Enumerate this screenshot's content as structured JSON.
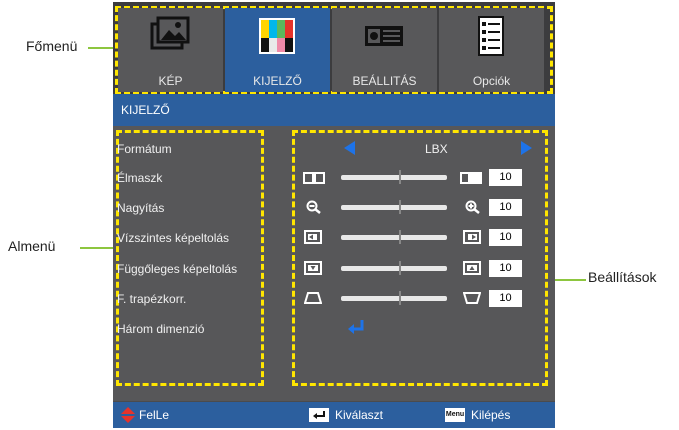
{
  "callouts": {
    "main_menu": "Főmenü",
    "sub_menu": "Almenü",
    "settings": "Beállítások"
  },
  "tabs": [
    {
      "label": "KÉP",
      "icon": "picture-icon"
    },
    {
      "label": "KIJELZŐ",
      "icon": "display-icon"
    },
    {
      "label": "BEÁLLITÁS",
      "icon": "projector-icon"
    },
    {
      "label": "Opciók",
      "icon": "options-icon"
    }
  ],
  "header": {
    "title": "KIJELZŐ"
  },
  "menu_items": [
    "Formátum",
    "Élmaszk",
    "Nagyítás",
    "Vízszintes képeltolás",
    "Függőleges képeltolás",
    "F. trapézkorr.",
    "Három dimenzió"
  ],
  "settings": {
    "format_value": "LBX",
    "edge_mask": "10",
    "zoom": "10",
    "h_shift": "10",
    "v_shift": "10",
    "keystone": "10"
  },
  "footer": {
    "updown": "FelLe",
    "select": "Kiválaszt",
    "menu_key": "Menu",
    "exit": "Kilépés"
  },
  "colors": {
    "accent_blue": "#2c5f9e",
    "highlight_yellow": "#ffe600",
    "leader_green": "#8dc63f",
    "arrow_blue": "#1e73e8",
    "updown_red": "#e6332a"
  }
}
